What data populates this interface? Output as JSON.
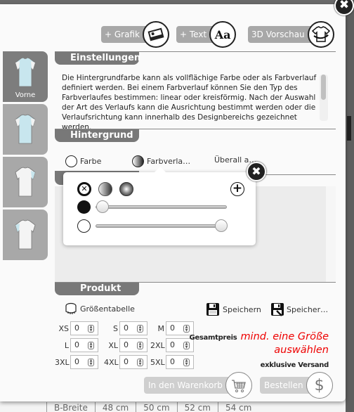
{
  "toolbar": {
    "grafik_label": "+ Grafik",
    "text_label": "+ Text",
    "text_icon_glyph": "Aa",
    "preview_label": "3D Vorschau"
  },
  "close_glyph": "✖",
  "views": [
    {
      "label": "Vorne",
      "active": true,
      "icon": "tshirt-front-icon"
    },
    {
      "label": "",
      "active": false,
      "icon": "tshirt-back-icon"
    },
    {
      "label": "",
      "active": false,
      "icon": "tshirt-left-sleeve-icon"
    },
    {
      "label": "",
      "active": false,
      "icon": "tshirt-right-sleeve-icon"
    }
  ],
  "settings": {
    "title": "Einstellungen",
    "description": "Die Hintergrundfarbe kann als vollflächige Farbe oder als Farbverlauf definiert werden. Bei einem Farbverlauf können Sie den Typ des Farbverlaufes bestimmen: linear oder kreisförmig. Nach der Auswahl der Art des Verlaufs kann die Ausrichtung bestimmt werden oder die Verlaufsrichtung kann innerhalb des Designbereichs gezeichnet werden."
  },
  "background": {
    "title": "Hintergrund",
    "options": [
      {
        "label": "Farbe",
        "selected": false
      },
      {
        "label": "Farbverla…",
        "selected": true
      },
      {
        "label": "Überall a…",
        "selected": false
      }
    ]
  },
  "gradient_popover": {
    "types": [
      "none",
      "linear",
      "radial"
    ],
    "none_glyph": "✕",
    "add_glyph": "+",
    "stops": [
      {
        "color": "#111111",
        "position": 0.0
      },
      {
        "color": "#ffffff",
        "position": 1.0
      }
    ]
  },
  "product": {
    "title": "Produkt",
    "size_table_label": "Größentabelle",
    "save_label": "Speichern",
    "save_as_label": "Speicher…",
    "sizes": [
      [
        {
          "size": "XS",
          "qty": "0"
        },
        {
          "size": "S",
          "qty": "0"
        },
        {
          "size": "M",
          "qty": "0"
        }
      ],
      [
        {
          "size": "L",
          "qty": "0"
        },
        {
          "size": "XL",
          "qty": "0"
        },
        {
          "size": "2XL",
          "qty": "0"
        }
      ],
      [
        {
          "size": "3XL",
          "qty": "0"
        },
        {
          "size": "4XL",
          "qty": "0"
        },
        {
          "size": "5XL",
          "qty": "0"
        }
      ]
    ],
    "total_label": "Gesamtpreis",
    "total_message": "mind. eine Größe auswählen",
    "shipping_note": "exklusive Versand",
    "add_to_cart_label": "In den Warenkorb",
    "order_label": "Bestellen",
    "order_icon_glyph": "$"
  },
  "background_table": [
    "B-Breite",
    "48 cm",
    "50 cm",
    "52 cm",
    "54 cm"
  ],
  "colors": {
    "accent_red": "#e00000",
    "tab_gray": "#787878",
    "button_gray": "#a8a8a8"
  }
}
